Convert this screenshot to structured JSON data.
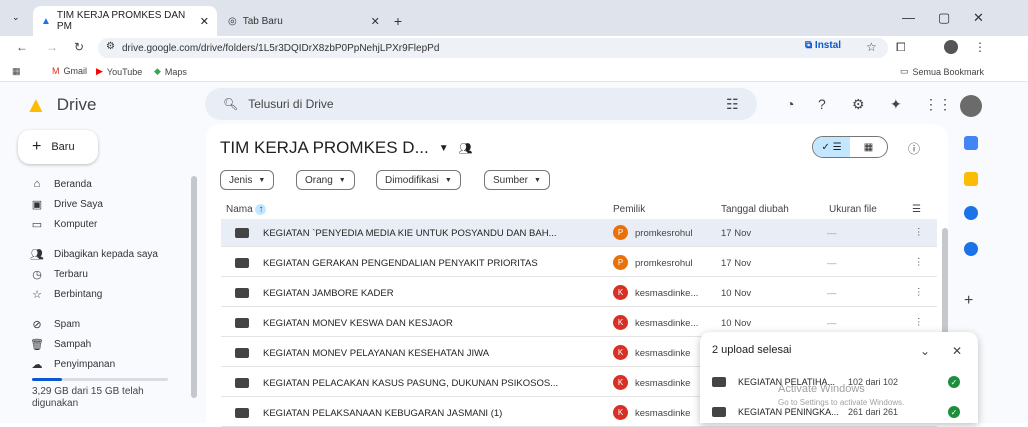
{
  "browser": {
    "active_tab": "TIM KERJA PROMKES DAN PM",
    "inactive_tab": "Tab Baru",
    "url": "drive.google.com/drive/folders/1L5r3DQIDrX8zbP0PpNehjLPXr9FlepPd",
    "install_label": "Instal",
    "bookmarks": [
      "Gmail",
      "YouTube",
      "Maps"
    ],
    "all_bookmarks": "Semua Bookmark"
  },
  "drive": {
    "logo_text": "Drive",
    "search_placeholder": "Telusuri di Drive",
    "new_button": "Baru",
    "sidebar": [
      {
        "label": "Beranda",
        "icon": "home-icon"
      },
      {
        "label": "Drive Saya",
        "icon": "my-drive-icon"
      },
      {
        "label": "Komputer",
        "icon": "computer-icon"
      },
      {
        "label": "Dibagikan kepada saya",
        "icon": "shared-icon"
      },
      {
        "label": "Terbaru",
        "icon": "clock-icon"
      },
      {
        "label": "Berbintang",
        "icon": "star-icon"
      },
      {
        "label": "Spam",
        "icon": "spam-icon"
      },
      {
        "label": "Sampah",
        "icon": "trash-icon"
      },
      {
        "label": "Penyimpanan",
        "icon": "cloud-icon"
      }
    ],
    "storage_text": "3,29 GB dari 15 GB telah digunakan",
    "storage_fraction": 0.22,
    "folder_title": "TIM KERJA PROMKES D...",
    "filters": [
      "Jenis",
      "Orang",
      "Dimodifikasi",
      "Sumber"
    ],
    "columns": {
      "name": "Nama",
      "owner": "Pemilik",
      "modified": "Tanggal diubah",
      "size": "Ukuran file"
    },
    "files": [
      {
        "name": "KEGIATAN `PENYEDIA MEDIA KIE UNTUK POSYANDU DAN BAH...",
        "owner": "promkesrohul",
        "initial": "P",
        "avatar_color": "#e8710a",
        "date": "17 Nov",
        "size": "—"
      },
      {
        "name": "KEGIATAN GERAKAN PENGENDALIAN PENYAKIT PRIORITAS",
        "owner": "promkesrohul",
        "initial": "P",
        "avatar_color": "#e8710a",
        "date": "17 Nov",
        "size": "—"
      },
      {
        "name": "KEGIATAN JAMBORE KADER",
        "owner": "kesmasdinke...",
        "initial": "K",
        "avatar_color": "#d93025",
        "date": "10 Nov",
        "size": "—"
      },
      {
        "name": "KEGIATAN MONEV KESWA DAN KESJAOR",
        "owner": "kesmasdinke...",
        "initial": "K",
        "avatar_color": "#d93025",
        "date": "10 Nov",
        "size": "—"
      },
      {
        "name": "KEGIATAN MONEV PELAYANAN KESEHATAN JIWA",
        "owner": "kesmasdinke",
        "initial": "K",
        "avatar_color": "#d93025",
        "date": "",
        "size": ""
      },
      {
        "name": "KEGIATAN PELACAKAN KASUS PASUNG, DUKUNAN PSIKOSOS...",
        "owner": "kesmasdinke",
        "initial": "K",
        "avatar_color": "#d93025",
        "date": "",
        "size": ""
      },
      {
        "name": "KEGIATAN PELAKSANAAN KEBUGARAN JASMANI (1)",
        "owner": "kesmasdinke",
        "initial": "K",
        "avatar_color": "#d93025",
        "date": "",
        "size": ""
      }
    ]
  },
  "upload_panel": {
    "title": "2 upload selesai",
    "items": [
      {
        "name": "KEGIATAN PELATIHA...",
        "count": "102 dari 102"
      },
      {
        "name": "KEGIATAN PENINGKA...",
        "count": "261 dari 261"
      }
    ]
  },
  "watermark": {
    "line1": "Activate Windows",
    "line2": "Go to Settings to activate Windows."
  }
}
